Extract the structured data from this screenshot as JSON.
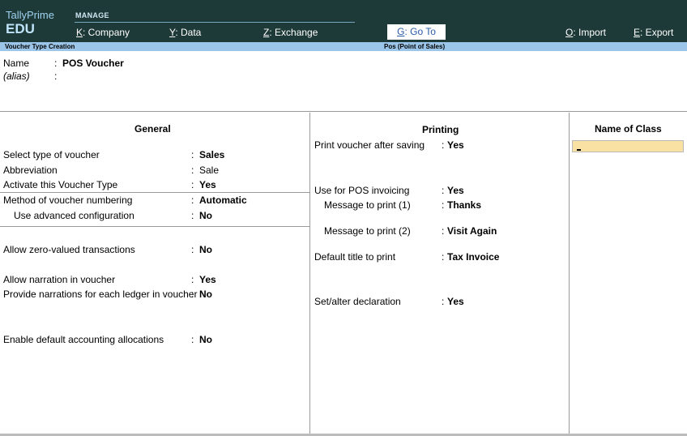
{
  "brand": {
    "name": "TallyPrime",
    "edition": "EDU"
  },
  "topmenu": {
    "section_label": "MANAGE",
    "items": [
      {
        "key": "K",
        "label": ": Company"
      },
      {
        "key": "Y",
        "label": ": Data"
      },
      {
        "key": "Z",
        "label": ": Exchange"
      },
      {
        "key": "G",
        "label": ": Go To"
      },
      {
        "key": "O",
        "label": ": Import"
      },
      {
        "key": "E",
        "label": ": Export"
      }
    ]
  },
  "titlebar": {
    "screen": "Voucher Type Creation",
    "context": "Pos (Point of Sales)"
  },
  "name_section": {
    "name_label": "Name",
    "name_value": "POS Voucher",
    "alias_label": "(alias)",
    "alias_value": ""
  },
  "general": {
    "heading": "General",
    "fields": [
      {
        "label": "Select type of voucher",
        "value": "Sales"
      },
      {
        "label": "Abbreviation",
        "value": "Sale"
      },
      {
        "label": "Activate this Voucher Type",
        "value": "Yes"
      },
      {
        "label": "Method of voucher numbering",
        "value": "Automatic"
      },
      {
        "label": "Use advanced configuration",
        "value": "No"
      },
      {
        "label": "Allow zero-valued transactions",
        "value": "No"
      },
      {
        "label": "Allow narration in voucher",
        "value": "Yes"
      },
      {
        "label": "Provide narrations for each ledger in voucher",
        "value": "No"
      },
      {
        "label": "Enable default accounting allocations",
        "value": "No"
      }
    ]
  },
  "printing": {
    "heading": "Printing",
    "fields": [
      {
        "label": "Print voucher after saving",
        "value": "Yes"
      },
      {
        "label": "Use for POS invoicing",
        "value": "Yes"
      },
      {
        "label": "Message to print (1)",
        "value": "Thanks"
      },
      {
        "label": "Message to print (2)",
        "value": "Visit Again"
      },
      {
        "label": "Default title to print",
        "value": "Tax Invoice"
      },
      {
        "label": "Set/alter declaration",
        "value": "Yes"
      }
    ]
  },
  "class_panel": {
    "heading": "Name of Class",
    "input_value": ""
  },
  "colors": {
    "topbar": "#1e3a38",
    "titlebar": "#9bc6e9",
    "active_input": "#f9e1a4"
  }
}
